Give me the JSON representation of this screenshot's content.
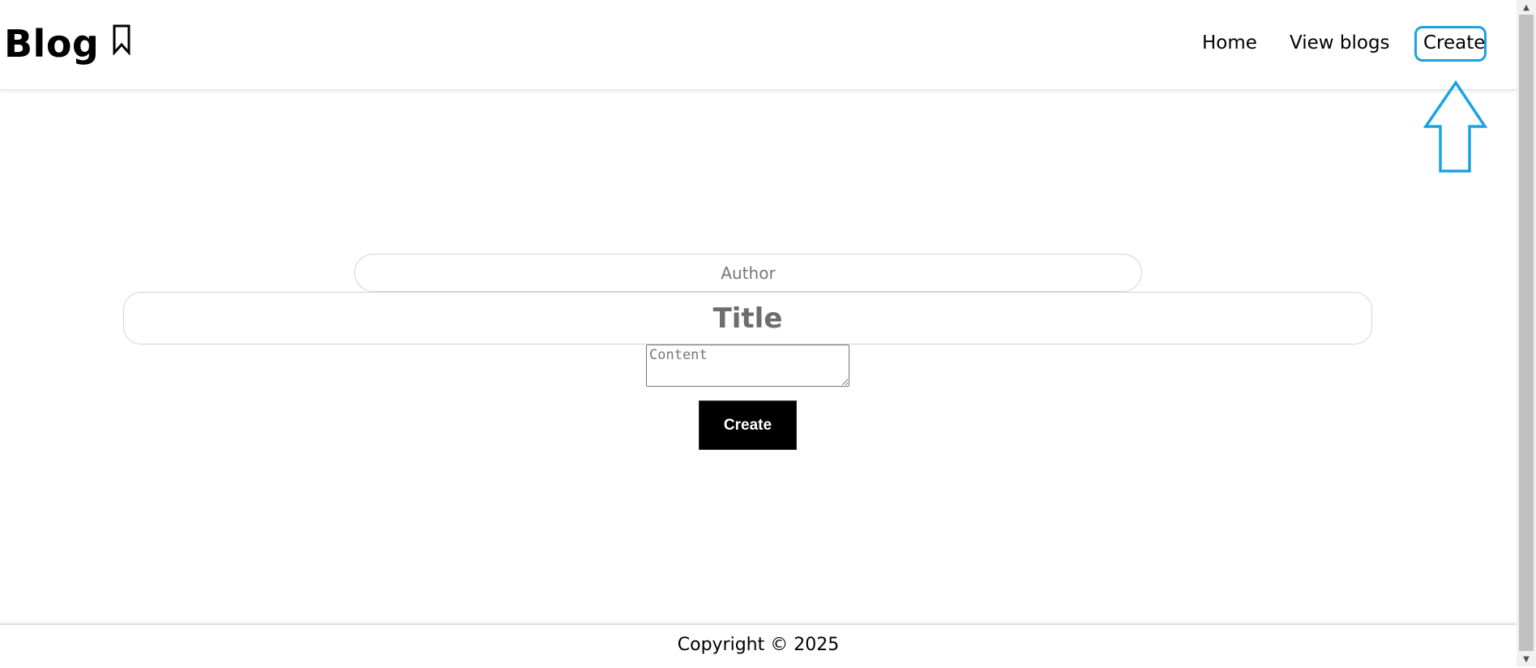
{
  "header": {
    "brand_title": "Blog",
    "brand_icon": "bookmark-icon",
    "nav": {
      "home_label": "Home",
      "view_blogs_label": "View blogs",
      "create_label": "Create"
    }
  },
  "annotation": {
    "highlight_color": "#1aa3e0",
    "arrow_icon": "up-arrow-icon"
  },
  "form": {
    "author_placeholder": "Author",
    "author_value": "",
    "title_placeholder": "Title",
    "title_value": "",
    "content_placeholder": "Content",
    "content_value": "",
    "submit_label": "Create"
  },
  "footer": {
    "copyright": "Copyright © 2025"
  },
  "colors": {
    "button_bg": "#000000",
    "button_text": "#ffffff",
    "background": "#ffffff"
  }
}
